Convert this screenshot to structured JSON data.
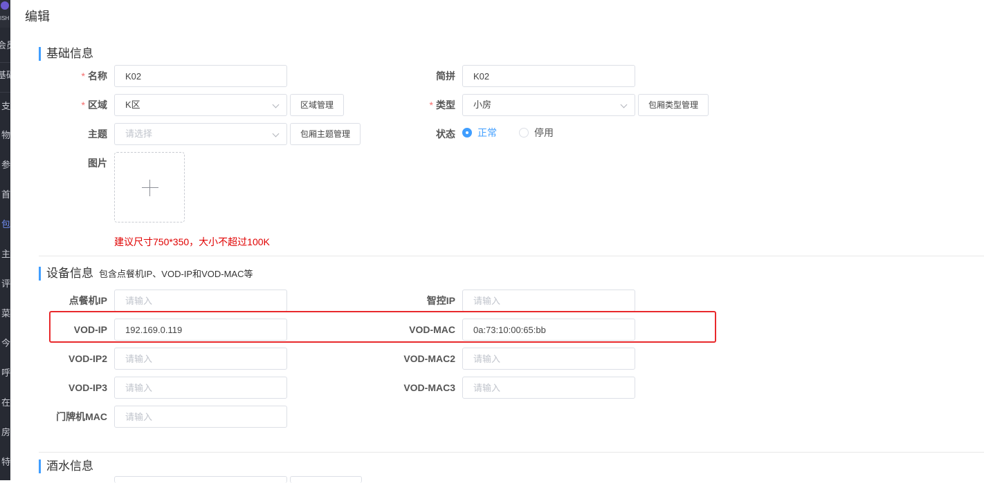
{
  "page": {
    "title": "编辑"
  },
  "sidebar": {
    "logo_text": "ISH",
    "items": [
      "会员",
      "基础",
      "支",
      "物",
      "参",
      "首",
      "包",
      "主",
      "评",
      "菜",
      "今",
      "呼",
      "在",
      "房",
      "特"
    ]
  },
  "basic": {
    "title": "基础信息",
    "name": {
      "label": "名称",
      "value": "K02"
    },
    "pinyin": {
      "label": "简拼",
      "value": "K02"
    },
    "area": {
      "label": "区域",
      "value": "K区",
      "button": "区域管理"
    },
    "type": {
      "label": "类型",
      "value": "小房",
      "button": "包厢类型管理"
    },
    "theme": {
      "label": "主题",
      "placeholder": "请选择",
      "button": "包厢主题管理"
    },
    "status": {
      "label": "状态",
      "options": [
        "正常",
        "停用"
      ],
      "selected": "正常"
    },
    "image": {
      "label": "图片",
      "hint": "建议尺寸750*350，大小不超过100K"
    }
  },
  "device": {
    "title": "设备信息",
    "subtitle": "包含点餐机IP、VOD-IP和VOD-MAC等",
    "order_ip": {
      "label": "点餐机IP",
      "placeholder": "请输入"
    },
    "smart_ip": {
      "label": "智控IP",
      "placeholder": "请输入"
    },
    "vod_ip": {
      "label": "VOD-IP",
      "value": "192.169.0.119"
    },
    "vod_mac": {
      "label": "VOD-MAC",
      "value": "0a:73:10:00:65:bb"
    },
    "vod_ip2": {
      "label": "VOD-IP2",
      "placeholder": "请输入"
    },
    "vod_mac2": {
      "label": "VOD-MAC2",
      "placeholder": "请输入"
    },
    "vod_ip3": {
      "label": "VOD-IP3",
      "placeholder": "请输入"
    },
    "vod_mac3": {
      "label": "VOD-MAC3",
      "placeholder": "请输入"
    },
    "door_mac": {
      "label": "门牌机MAC",
      "placeholder": "请输入"
    }
  },
  "drinks": {
    "title": "酒水信息"
  },
  "colors": {
    "accent": "#409eff",
    "required": "#f56c6c",
    "highlight": "#e8282b",
    "hint": "#e00000"
  }
}
